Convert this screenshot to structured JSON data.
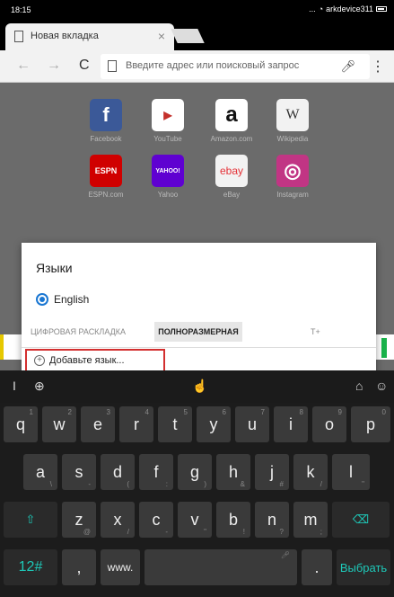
{
  "status": {
    "time": "18:15",
    "wifi": "arkdevice311"
  },
  "browser": {
    "tab_title": "Новая вкладка",
    "omnibox_placeholder": "Введите адрес или поисковый запрос"
  },
  "tiles": [
    {
      "label": "Facebook",
      "glyph": "f",
      "color": "#3b5998"
    },
    {
      "label": "YouTube",
      "glyph": "▶",
      "color": "#c4302b"
    },
    {
      "label": "Amazon.com",
      "glyph": "a",
      "color": "#ffffff"
    },
    {
      "label": "Wikipedia",
      "glyph": "W",
      "color": "#f2f2f2"
    },
    {
      "label": "ESPN.com",
      "glyph": "ESPN",
      "color": "#d00000"
    },
    {
      "label": "Yahoo",
      "glyph": "YAHOO!",
      "color": "#5f01d1"
    },
    {
      "label": "eBay",
      "glyph": "ebay",
      "color": "#f2f2f2"
    },
    {
      "label": "Instagram",
      "glyph": "◎",
      "color": "#c13584"
    }
  ],
  "dialog": {
    "title": "Языки",
    "language": "English",
    "layout_options": [
      "ЦИФРОВАЯ РАСКЛАДКА",
      "ПОЛНОРАЗМЕРНАЯ",
      "T+"
    ],
    "selected_layout": "ПОЛНОРАЗМЕРНАЯ",
    "add_language": "Добавьте язык..."
  },
  "keyboard": {
    "row1": [
      {
        "k": "q",
        "h": "1"
      },
      {
        "k": "w",
        "h": "2"
      },
      {
        "k": "e",
        "h": "3"
      },
      {
        "k": "r",
        "h": "4"
      },
      {
        "k": "t",
        "h": "5"
      },
      {
        "k": "y",
        "h": "6"
      },
      {
        "k": "u",
        "h": "7"
      },
      {
        "k": "i",
        "h": "8"
      },
      {
        "k": "o",
        "h": "9"
      },
      {
        "k": "p",
        "h": "0"
      }
    ],
    "row2": [
      {
        "k": "a",
        "h": "\\"
      },
      {
        "k": "s",
        "h": "-"
      },
      {
        "k": "d",
        "h": "("
      },
      {
        "k": "f",
        "h": ":"
      },
      {
        "k": "g",
        "h": ")"
      },
      {
        "k": "h",
        "h": "&"
      },
      {
        "k": "j",
        "h": "#"
      },
      {
        "k": "k",
        "h": "/"
      },
      {
        "k": "l",
        "h": "\""
      }
    ],
    "row3": [
      {
        "k": "z",
        "h": "@"
      },
      {
        "k": "x",
        "h": "/"
      },
      {
        "k": "c",
        "h": "-"
      },
      {
        "k": "v",
        "h": "\""
      },
      {
        "k": "b",
        "h": "!"
      },
      {
        "k": "n",
        "h": "?"
      },
      {
        "k": "m",
        "h": ";"
      }
    ],
    "mode_key": "12#",
    "comma_key": ",",
    "www_key": "www.",
    "period_key": ".",
    "action_key": "Выбрать"
  }
}
